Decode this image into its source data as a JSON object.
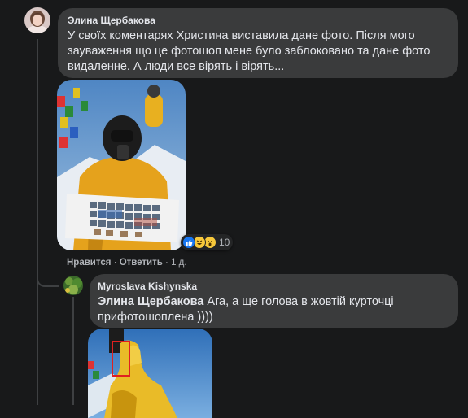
{
  "comment1": {
    "author": "Элина Щербакова",
    "text": "У своїх коментарях Христина виставила дане фото. Після мого зауваження що це фотошоп мене було заблоковано та дане фото видаленне. А люди все вірять і вірять...",
    "reactions": {
      "icons": [
        "like-icon",
        "laugh-icon",
        "wow-icon"
      ],
      "count": "10"
    },
    "actions": {
      "like": "Нравится",
      "sep1": " · ",
      "reply": "Ответить",
      "sep2": " · ",
      "time": "1 д."
    }
  },
  "comment2": {
    "author": "Myroslava Kishynska",
    "mention": "Элина Щербакова",
    "text": " Ага, а ще голова в жовтій курточці прифотошоплена ))))"
  },
  "colors": {
    "background": "#18191a",
    "bubble": "#3a3b3c",
    "text": "#e4e6eb",
    "secondary": "#b0b3b8",
    "like_blue": "#1877f2",
    "highlight_red": "#e02020"
  }
}
